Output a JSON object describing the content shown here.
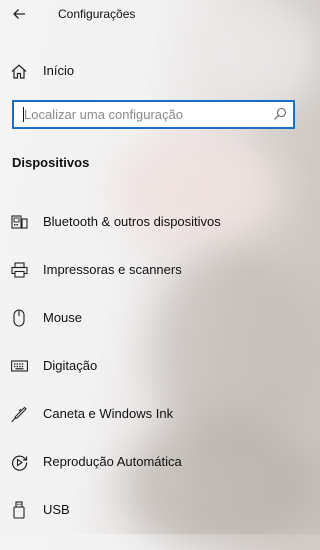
{
  "window": {
    "title": "Configurações"
  },
  "nav": {
    "home": {
      "label": "Início",
      "icon": "home-icon"
    }
  },
  "search": {
    "value": "",
    "placeholder": "Localizar uma configuração",
    "icon": "search-icon"
  },
  "section": {
    "title": "Dispositivos"
  },
  "menu": {
    "items": [
      {
        "label": "Bluetooth & outros dispositivos",
        "icon": "bluetooth-devices-icon"
      },
      {
        "label": "Impressoras e scanners",
        "icon": "printer-icon"
      },
      {
        "label": "Mouse",
        "icon": "mouse-icon"
      },
      {
        "label": "Digitação",
        "icon": "keyboard-icon"
      },
      {
        "label": "Caneta e Windows Ink",
        "icon": "pen-icon"
      },
      {
        "label": "Reprodução Automática",
        "icon": "autoplay-icon"
      },
      {
        "label": "USB",
        "icon": "usb-icon"
      }
    ]
  },
  "colors": {
    "accent": "#1a6fc4",
    "text": "#111111",
    "placeholder": "#8a8a8a"
  }
}
